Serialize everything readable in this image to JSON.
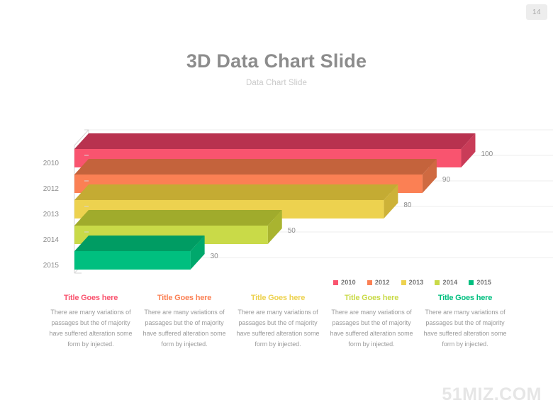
{
  "page": {
    "number": "14"
  },
  "header": {
    "title": "3D Data Chart Slide",
    "subtitle": "Data Chart Slide"
  },
  "watermark": "51MIZ.COM",
  "legend": {
    "items": [
      {
        "label": "2010",
        "color": "#f9546f"
      },
      {
        "label": "2012",
        "color": "#fb8054"
      },
      {
        "label": "2013",
        "color": "#edd24f"
      },
      {
        "label": "2014",
        "color": "#c9da48"
      },
      {
        "label": "2015",
        "color": "#00bf7f"
      }
    ]
  },
  "columns": [
    {
      "title": "Title Goes here",
      "color": "#f9546f",
      "body": "There are many variations of passages but the of majority have suffered alteration some form by injected."
    },
    {
      "title": "Title Goes here",
      "color": "#fb8054",
      "body": "There are many variations of passages but the of majority have suffered alteration some form by injected."
    },
    {
      "title": "Title Goes here",
      "color": "#edd24f",
      "body": "There are many variations of passages but the of majority have suffered alteration some form by injected."
    },
    {
      "title": "Title Goes here",
      "color": "#c9da48",
      "body": "There are many variations of passages but the of majority have suffered alteration some form by injected."
    },
    {
      "title": "Title Goes here",
      "color": "#00bf7f",
      "body": "There are many variations of passages but the of majority have suffered alteration some form by injected."
    }
  ],
  "chart_data": {
    "type": "bar",
    "orientation": "horizontal",
    "style": "3d",
    "title": "3D Data Chart Slide",
    "subtitle": "Data Chart Slide",
    "xlabel": "",
    "ylabel": "",
    "categories": [
      "2010",
      "2012",
      "2013",
      "2014",
      "2015"
    ],
    "values": [
      100,
      90,
      80,
      50,
      30
    ],
    "data_labels": [
      "100",
      "90",
      "80",
      "50",
      "30"
    ],
    "colors": [
      "#f9546f",
      "#fb8054",
      "#edd24f",
      "#c9da48",
      "#00bf7f"
    ],
    "top_face_colors": [
      "#b8324f",
      "#c4633c",
      "#c4ab33",
      "#a0ab2c",
      "#009c63"
    ],
    "side_face_colors": [
      "#c93c58",
      "#cf6a41",
      "#cdb238",
      "#a9b430",
      "#00a86c"
    ],
    "xlim": [
      0,
      110
    ],
    "grid": true,
    "gridline_color": "#ececec",
    "legend_position": "bottom-right",
    "axis_color": "#d6d6d6",
    "tick_label_color": "#8c8c8c",
    "data_label_color": "#8c8c8c",
    "series": [
      {
        "name": "2010",
        "value": 100
      },
      {
        "name": "2012",
        "value": 90
      },
      {
        "name": "2013",
        "value": 80
      },
      {
        "name": "2014",
        "value": 50
      },
      {
        "name": "2015",
        "value": 30
      }
    ]
  }
}
